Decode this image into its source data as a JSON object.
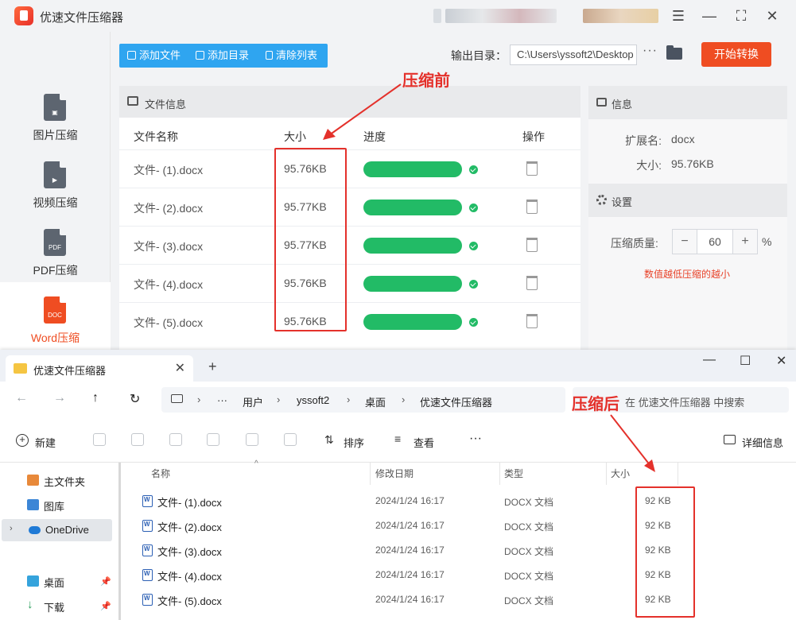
{
  "app": {
    "title": "优速文件压缩器",
    "sidebar": [
      {
        "label": "图片压缩",
        "glyph": "▣"
      },
      {
        "label": "视频压缩",
        "glyph": "▶"
      },
      {
        "label": "PDF压缩",
        "glyph": "PDF"
      },
      {
        "label": "Word压缩",
        "glyph": "DOC"
      }
    ],
    "toolbar": {
      "add_file": "添加文件",
      "add_dir": "添加目录",
      "clear": "清除列表"
    },
    "output": {
      "label": "输出目录：",
      "path": "C:\\Users\\yssoft2\\Desktop",
      "more": "···",
      "start": "开始转换"
    },
    "file_panel": {
      "title": "文件信息",
      "headers": {
        "name": "文件名称",
        "size": "大小",
        "progress": "进度",
        "action": "操作"
      },
      "rows": [
        {
          "name": "文件- (1).docx",
          "size": "95.76KB",
          "progress": 1.0
        },
        {
          "name": "文件- (2).docx",
          "size": "95.77KB",
          "progress": 1.0
        },
        {
          "name": "文件- (3).docx",
          "size": "95.77KB",
          "progress": 1.0
        },
        {
          "name": "文件- (4).docx",
          "size": "95.76KB",
          "progress": 1.0
        },
        {
          "name": "文件- (5).docx",
          "size": "95.76KB",
          "progress": 1.0
        }
      ]
    },
    "info": {
      "title": "信息",
      "ext_label": "扩展名:",
      "ext_value": "docx",
      "size_label": "大小:",
      "size_value": "95.76KB"
    },
    "settings": {
      "title": "设置",
      "quality_label": "压缩质量:",
      "quality_value": "60",
      "minus": "−",
      "plus": "+",
      "unit": "%",
      "hint": "数值越低压缩的越小"
    }
  },
  "annotations": {
    "before": "压缩前",
    "after": "压缩后"
  },
  "explorer": {
    "tab_title": "优速文件压缩器",
    "tab_close": "✕",
    "tab_add": "+",
    "window_buttons": {
      "minimize": "—",
      "maximize": "☐",
      "close": "✕"
    },
    "nav": {
      "back": "←",
      "forward": "→",
      "up": "↑",
      "refresh": "↻"
    },
    "breadcrumb": {
      "more": "···",
      "sep": "›",
      "items": [
        "用户",
        "yssoft2",
        "桌面",
        "优速文件压缩器"
      ]
    },
    "search_placeholder": "在 优速文件压缩器 中搜索",
    "commands": {
      "new": "新建",
      "sort": "排序",
      "view": "查看",
      "more": "···",
      "details": "详细信息"
    },
    "nav_pane": [
      {
        "label": "主文件夹",
        "color": "#e8893a"
      },
      {
        "label": "图库",
        "color": "#3c86d6"
      },
      {
        "label": "OneDrive",
        "color": "#1f7ad6"
      },
      {
        "label": "桌面",
        "color": "#35a3dc"
      },
      {
        "label": "下载",
        "color": "#2a9d5c"
      }
    ],
    "columns": {
      "name": "名称",
      "modified": "修改日期",
      "type": "类型",
      "size": "大小"
    },
    "files": [
      {
        "name": "文件- (1).docx",
        "modified": "2024/1/24 16:17",
        "type": "DOCX 文档",
        "size": "92 KB"
      },
      {
        "name": "文件- (2).docx",
        "modified": "2024/1/24 16:17",
        "type": "DOCX 文档",
        "size": "92 KB"
      },
      {
        "name": "文件- (3).docx",
        "modified": "2024/1/24 16:17",
        "type": "DOCX 文档",
        "size": "92 KB"
      },
      {
        "name": "文件- (4).docx",
        "modified": "2024/1/24 16:17",
        "type": "DOCX 文档",
        "size": "92 KB"
      },
      {
        "name": "文件- (5).docx",
        "modified": "2024/1/24 16:17",
        "type": "DOCX 文档",
        "size": "92 KB"
      }
    ]
  },
  "colors": {
    "accent": "#ef4d22",
    "toolbar_blue": "#2fa5f0",
    "progress_green": "#22bb66",
    "annotation_red": "#e4312b"
  }
}
